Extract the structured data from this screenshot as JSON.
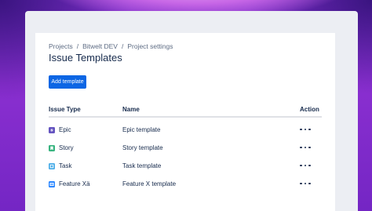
{
  "breadcrumb": {
    "items": [
      "Projects",
      "Bitwelt DEV",
      "Project settings"
    ],
    "separator": "/"
  },
  "page": {
    "title": "Issue Templates"
  },
  "toolbar": {
    "add_template_label": "Add template"
  },
  "table": {
    "columns": {
      "issue_type": "Issue Type",
      "name": "Name",
      "action": "Action"
    },
    "rows": [
      {
        "type": "Epic",
        "name": "Epic template",
        "icon": "epic-icon",
        "color": "#6554c0"
      },
      {
        "type": "Story",
        "name": "Story template",
        "icon": "story-icon",
        "color": "#36b37e"
      },
      {
        "type": "Task",
        "name": "Task template",
        "icon": "task-icon",
        "color": "#4bade8"
      },
      {
        "type": "Feature Xä",
        "name": "Feature X template",
        "icon": "feature-icon",
        "color": "#2684ff"
      }
    ]
  },
  "colors": {
    "primary_button": "#0c66e4",
    "text": "#172b4d",
    "subtle_text": "#5e6c84"
  }
}
